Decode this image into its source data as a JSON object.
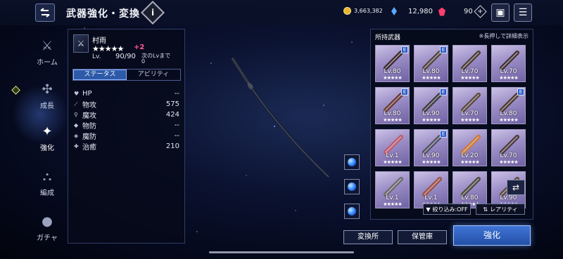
{
  "header": {
    "title": "武器強化・変換",
    "info_label": "i",
    "gil": "3,663,382",
    "crystals": "12,980",
    "gems": "90"
  },
  "nav": {
    "items": [
      {
        "label": "ホーム",
        "icon": "home-icon"
      },
      {
        "label": "成長",
        "icon": "growth-icon"
      },
      {
        "label": "強化",
        "icon": "enhance-icon"
      },
      {
        "label": "編成",
        "icon": "party-icon"
      },
      {
        "label": "ガチャ",
        "icon": "gacha-icon"
      }
    ],
    "active": "強化"
  },
  "weapon": {
    "name": "村雨",
    "stars": "★★★★★",
    "plus": "+2",
    "lv_label": "Lv.",
    "lv_value": "90/90",
    "next_label": "次のLvまで",
    "next_value": "0"
  },
  "tabs": [
    "ステータス",
    "アビリティ"
  ],
  "stats": [
    {
      "label": "HP",
      "value": "--"
    },
    {
      "label": "物攻",
      "value": "575"
    },
    {
      "label": "魔攻",
      "value": "424"
    },
    {
      "label": "物防",
      "value": "--"
    },
    {
      "label": "魔防",
      "value": "--"
    },
    {
      "label": "治癒",
      "value": "210"
    }
  ],
  "inventory": {
    "title": "所持武器",
    "hint": "※長押しで詳細表示",
    "slots": [
      {
        "lv": "Lv.80",
        "stars": "★★★★★",
        "equipped": "E"
      },
      {
        "lv": "Lv.80",
        "stars": "★★★★★",
        "equipped": "E"
      },
      {
        "lv": "Lv.70",
        "stars": "★★★★★",
        "equipped": ""
      },
      {
        "lv": "Lv.70",
        "stars": "★★★★★",
        "equipped": ""
      },
      {
        "lv": "Lv.80",
        "stars": "★★★★★",
        "equipped": "E"
      },
      {
        "lv": "Lv.90",
        "stars": "★★★★★",
        "equipped": "E"
      },
      {
        "lv": "Lv.70",
        "stars": "★★★★★",
        "equipped": ""
      },
      {
        "lv": "Lv.80",
        "stars": "★★★★★",
        "equipped": "E"
      },
      {
        "lv": "Lv.1",
        "stars": "★★★★★",
        "equipped": ""
      },
      {
        "lv": "Lv.90",
        "stars": "★★★★★",
        "equipped": "E"
      },
      {
        "lv": "Lv.20",
        "stars": "★★★★★",
        "equipped": ""
      },
      {
        "lv": "Lv.70",
        "stars": "★★★★★",
        "equipped": ""
      },
      {
        "lv": "Lv.1",
        "stars": "★★★★★",
        "equipped": ""
      },
      {
        "lv": "Lv.1",
        "stars": "★★★★★",
        "equipped": ""
      },
      {
        "lv": "Lv.80",
        "stars": "★★★★★",
        "equipped": ""
      },
      {
        "lv": "Lv.90",
        "stars": "★★★★★",
        "equipped": ""
      }
    ],
    "filter_label": "絞り込み:OFF",
    "rarity_label": "レアリティ"
  },
  "buttons": {
    "convert": "変換所",
    "storage": "保管庫",
    "enhance": "強化"
  }
}
